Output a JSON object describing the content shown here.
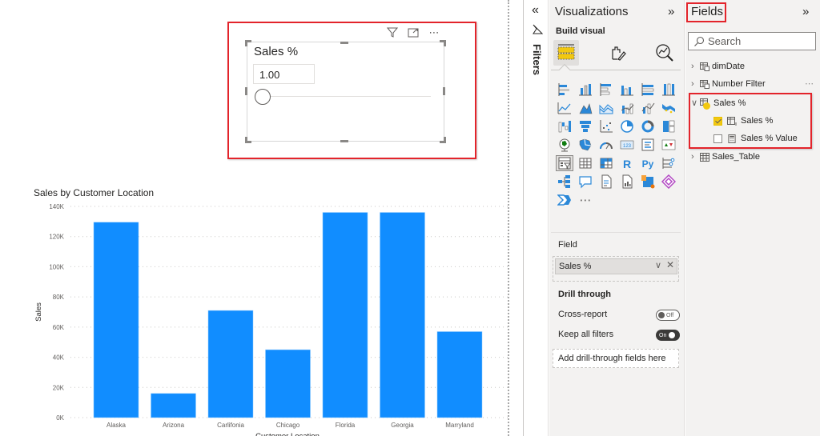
{
  "slicer": {
    "title": "Sales %",
    "value": "1.00",
    "slider_position": 0,
    "header_icons": [
      "filter-icon",
      "focus-mode-icon",
      "more-options-icon"
    ],
    "more_label": "⋯"
  },
  "chart_data": {
    "type": "bar",
    "title": "Sales by Customer Location",
    "xlabel": "Customer Location",
    "ylabel": "Sales",
    "categories": [
      "Alaska",
      "Arizona",
      "Carlifonia",
      "Chicago",
      "Florida",
      "Georgia",
      "Marryland"
    ],
    "values": [
      129500,
      16000,
      71000,
      45000,
      136000,
      136000,
      57000
    ],
    "ylim": [
      0,
      140000
    ],
    "yticks": [
      0,
      20000,
      40000,
      60000,
      80000,
      100000,
      120000,
      140000
    ],
    "ytick_labels": [
      "0K",
      "20K",
      "40K",
      "60K",
      "80K",
      "100K",
      "120K",
      "140K"
    ],
    "grid": true,
    "bar_color": "#118DFF"
  },
  "filters_pane": {
    "label": "Filters",
    "collapse_glyph": "«"
  },
  "visualizations": {
    "title": "Visualizations",
    "expand_glyph": "»",
    "build_visual_label": "Build visual",
    "modes": [
      "build-visual",
      "format-visual",
      "analytics"
    ],
    "more_label": "⋯",
    "field_label": "Field",
    "field_value": "Sales %",
    "drill_through_label": "Drill through",
    "cross_report_label": "Cross-report",
    "cross_report_state": "Off",
    "keep_filters_label": "Keep all filters",
    "keep_filters_state": "On",
    "add_drill_label": "Add drill-through fields here"
  },
  "fields": {
    "title": "Fields",
    "expand_glyph": "»",
    "search_placeholder": "Search",
    "tables": [
      {
        "name": "dimDate",
        "expanded": false
      },
      {
        "name": "Number Filter",
        "expanded": false
      },
      {
        "name": "Sales %",
        "expanded": true,
        "children": [
          {
            "name": "Sales %",
            "checked": true
          },
          {
            "name": "Sales % Value",
            "checked": false
          }
        ]
      },
      {
        "name": "Sales_Table",
        "expanded": false
      }
    ],
    "more_label": "⋯"
  },
  "accent_colors": {
    "highlight_red": "#E3242B",
    "bar_blue": "#118DFF",
    "pane_bg": "#F3F2F1",
    "check_yellow": "#F2C811"
  }
}
